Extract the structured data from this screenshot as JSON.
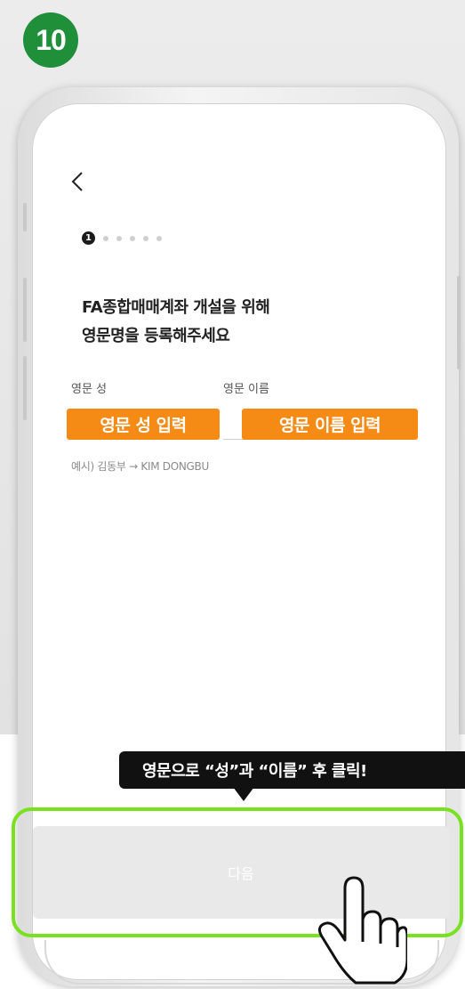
{
  "step": {
    "number": "10",
    "color": "#1f8f3a"
  },
  "nav": {
    "back_icon": "chevron-left-icon"
  },
  "progress": {
    "current": "1",
    "total_steps": 6
  },
  "headline": "FA종합매매계좌 개설을 위해\n영문명을 등록해주세요",
  "form": {
    "last_name": {
      "label": "영문 성",
      "value": ""
    },
    "first_name": {
      "label": "영문 이름",
      "value": ""
    },
    "example": "예시) 김동부 → KIM DONGBU"
  },
  "annotations": {
    "last_name_tag": "영문 성 입력",
    "first_name_tag": "영문 이름 입력",
    "tooltip": "영문으로 “성”과 “이름” 후 클릭!",
    "accent_color": "#f58a14",
    "highlight_color": "#78e21f"
  },
  "footer": {
    "next_label": "다음"
  }
}
